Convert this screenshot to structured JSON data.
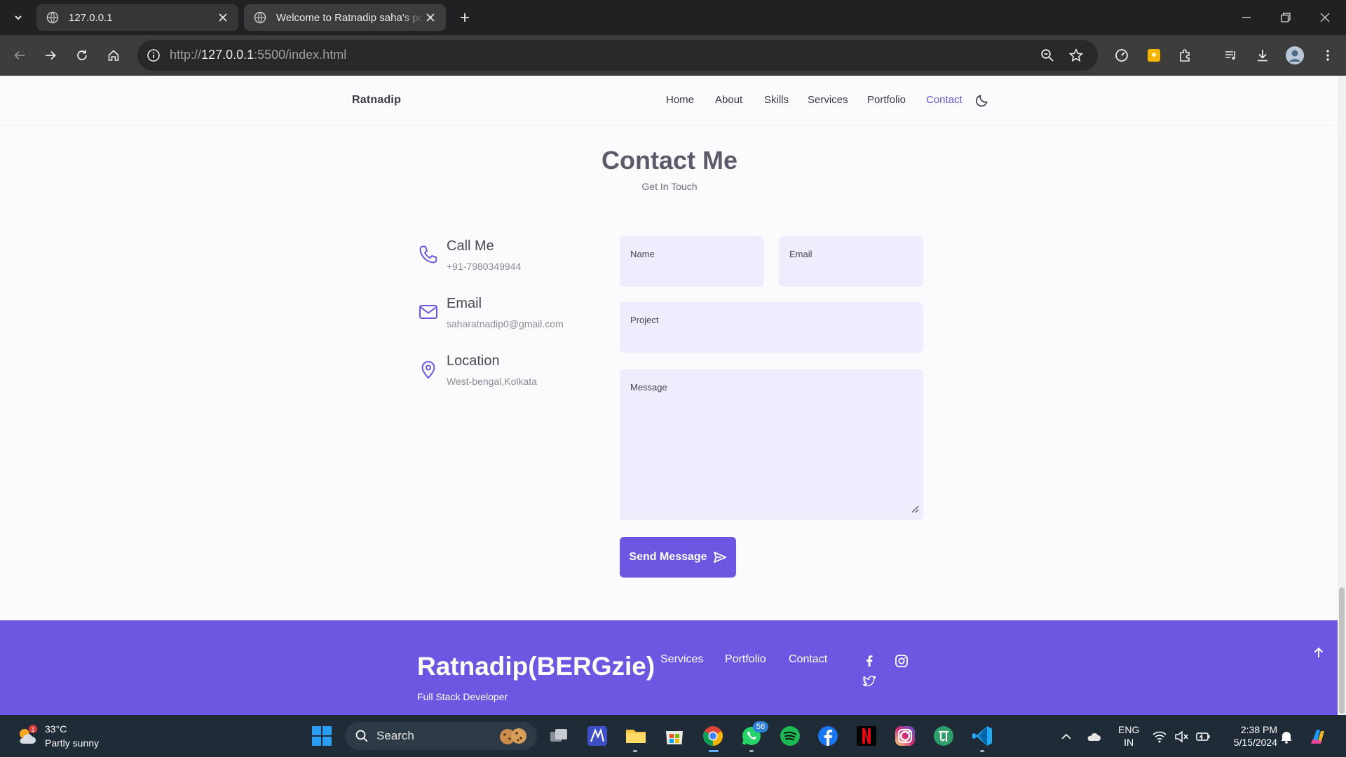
{
  "browser": {
    "tabs": [
      {
        "title": "127.0.0.1"
      },
      {
        "title": "Welcome to Ratnadip saha's portfolio"
      }
    ],
    "address": {
      "scheme": "http://",
      "host": "127.0.0.1",
      "rest": ":5500/index.html"
    }
  },
  "nav": {
    "logo": "Ratnadip",
    "links": [
      "Home",
      "About",
      "Skills",
      "Services",
      "Portfolio",
      "Contact"
    ],
    "active": "Contact"
  },
  "contact": {
    "title": "Contact Me",
    "subtitle": "Get In Touch",
    "info": [
      {
        "title": "Call Me",
        "value": "+91-7980349944",
        "icon": "phone-icon"
      },
      {
        "title": "Email",
        "value": "saharatnadip0@gmail.com",
        "icon": "mail-icon"
      },
      {
        "title": "Location",
        "value": "West-bengal,Kolkata",
        "icon": "location-pin-icon"
      }
    ],
    "form": {
      "name_label": "Name",
      "email_label": "Email",
      "project_label": "Project",
      "message_label": "Message",
      "send_label": "Send Message"
    }
  },
  "footer": {
    "title": "Ratnadip(BERGzie)",
    "subtitle": "Full Stack Developer",
    "links": [
      "Services",
      "Portfolio",
      "Contact"
    ],
    "social": [
      "facebook-icon",
      "instagram-icon",
      "twitter-icon"
    ]
  },
  "taskbar": {
    "weather_temp": "33°C",
    "weather_desc": "Partly sunny",
    "weather_badge": "1",
    "search_placeholder": "Search",
    "whatsapp_badge": "56",
    "lang_line1": "ENG",
    "lang_line2": "IN",
    "time": "2:38 PM",
    "date": "5/15/2024"
  },
  "colors": {
    "accent": "#6b57e1",
    "field_bg": "#efecfd",
    "page_bg": "#fbfbfe",
    "chrome_dark": "#202124",
    "taskbar_bg": "#1f2b36"
  }
}
